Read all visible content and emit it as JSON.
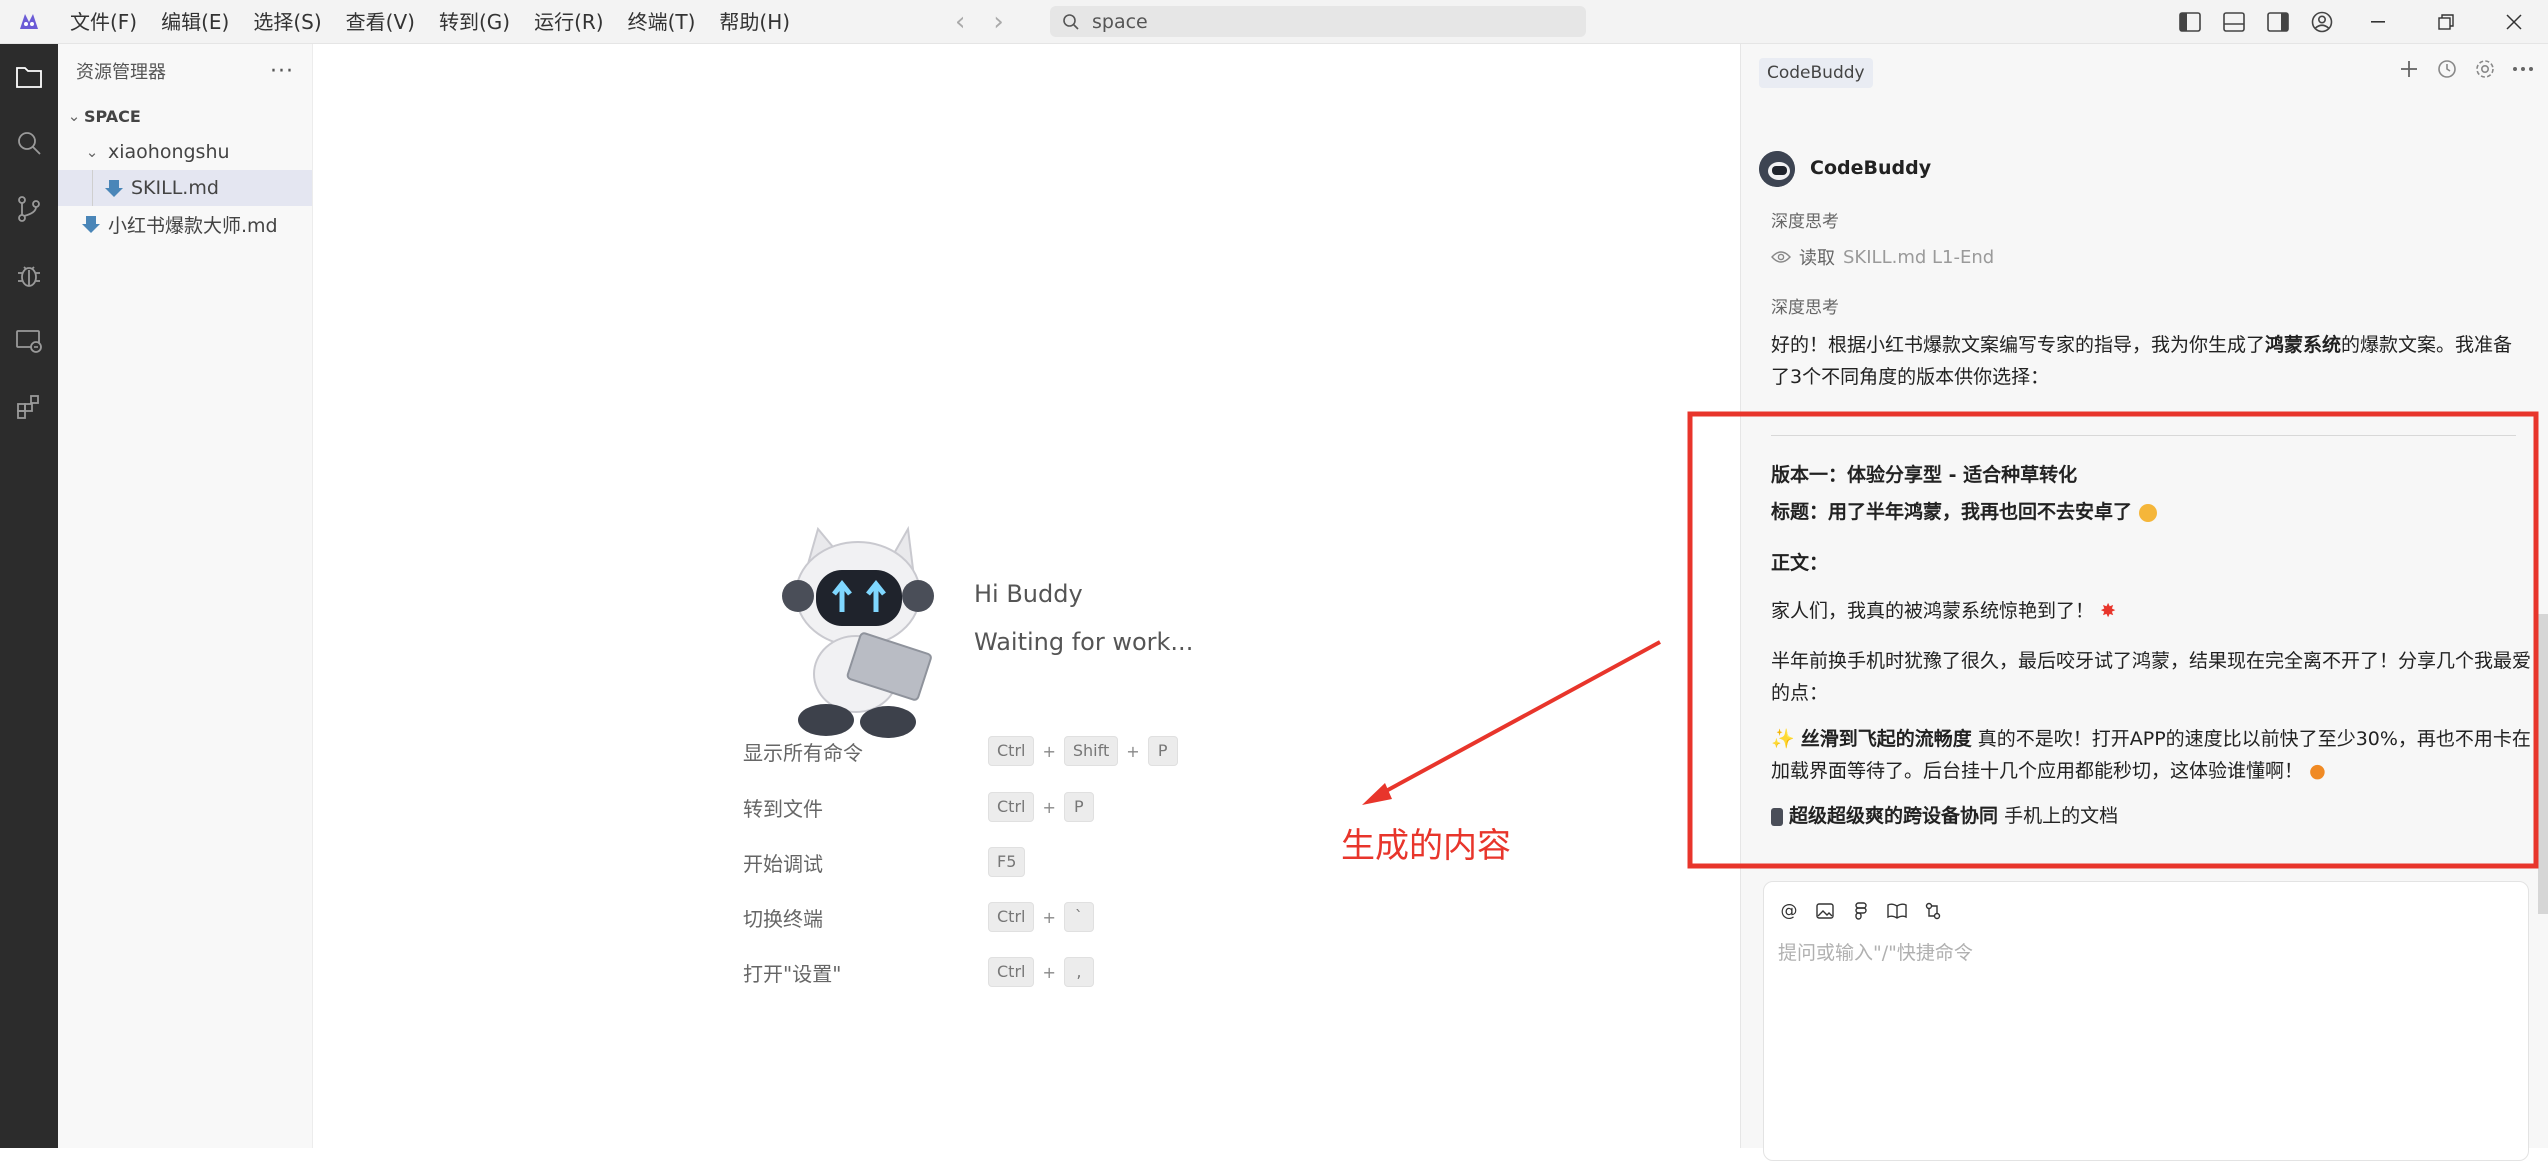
{
  "menu": [
    "文件(F)",
    "编辑(E)",
    "选择(S)",
    "查看(V)",
    "转到(G)",
    "运行(R)",
    "终端(T)",
    "帮助(H)"
  ],
  "search": {
    "value": "space"
  },
  "sidebar": {
    "title": "资源管理器",
    "more": "···",
    "root": "SPACE",
    "folder": "xiaohongshu",
    "files": [
      "SKILL.md",
      "小红书爆款大师.md"
    ]
  },
  "welcome": {
    "greeting": "Hi Buddy",
    "status": "Waiting for work...",
    "shortcuts": [
      {
        "label": "显示所有命令",
        "keys": [
          "Ctrl",
          "Shift",
          "P"
        ]
      },
      {
        "label": "转到文件",
        "keys": [
          "Ctrl",
          "P"
        ]
      },
      {
        "label": "开始调试",
        "keys": [
          "F5"
        ]
      },
      {
        "label": "切换终端",
        "keys": [
          "Ctrl",
          "`"
        ]
      },
      {
        "label": "打开\"设置\"",
        "keys": [
          "Ctrl",
          ","
        ]
      }
    ]
  },
  "annotation": {
    "label": "生成的内容",
    "color": "#e8352b"
  },
  "panel": {
    "tab": "CodeBuddy",
    "agent_name": "CodeBuddy",
    "thinking": "深度思考",
    "read_label": "读取",
    "read_file": "SKILL.md L1-End",
    "intro_pre": "好的！根据小红书爆款文案编写专家的指导，我为你生成了",
    "intro_bold": "鸿蒙系统",
    "intro_post": "的爆款文案。我准备了3个不同角度的版本供你选择：",
    "version_title": "版本一：体验分享型 - 适合种草转化",
    "headline": "标题：用了半年鸿蒙，我再也回不去安卓了",
    "body_label": "正文：",
    "p1": "家人们，我真的被鸿蒙系统惊艳到了！",
    "p2": "半年前换手机时犹豫了很久，最后咬牙试了鸿蒙，结果现在完全离不开了！分享几个我最爱的点：",
    "p3_bold": "丝滑到飞起的流畅度",
    "p3_rest": " 真的不是吹！打开APP的速度比以前快了至少30%，再也不用卡在加载界面等待了。后台挂十几个应用都能秒切，这体验谁懂啊！",
    "p4_bold": "超级超级爽的跨设备协同",
    "p4_rest": " 手机上的文档",
    "input_placeholder": "提问或输入\"/\"快捷命令"
  }
}
